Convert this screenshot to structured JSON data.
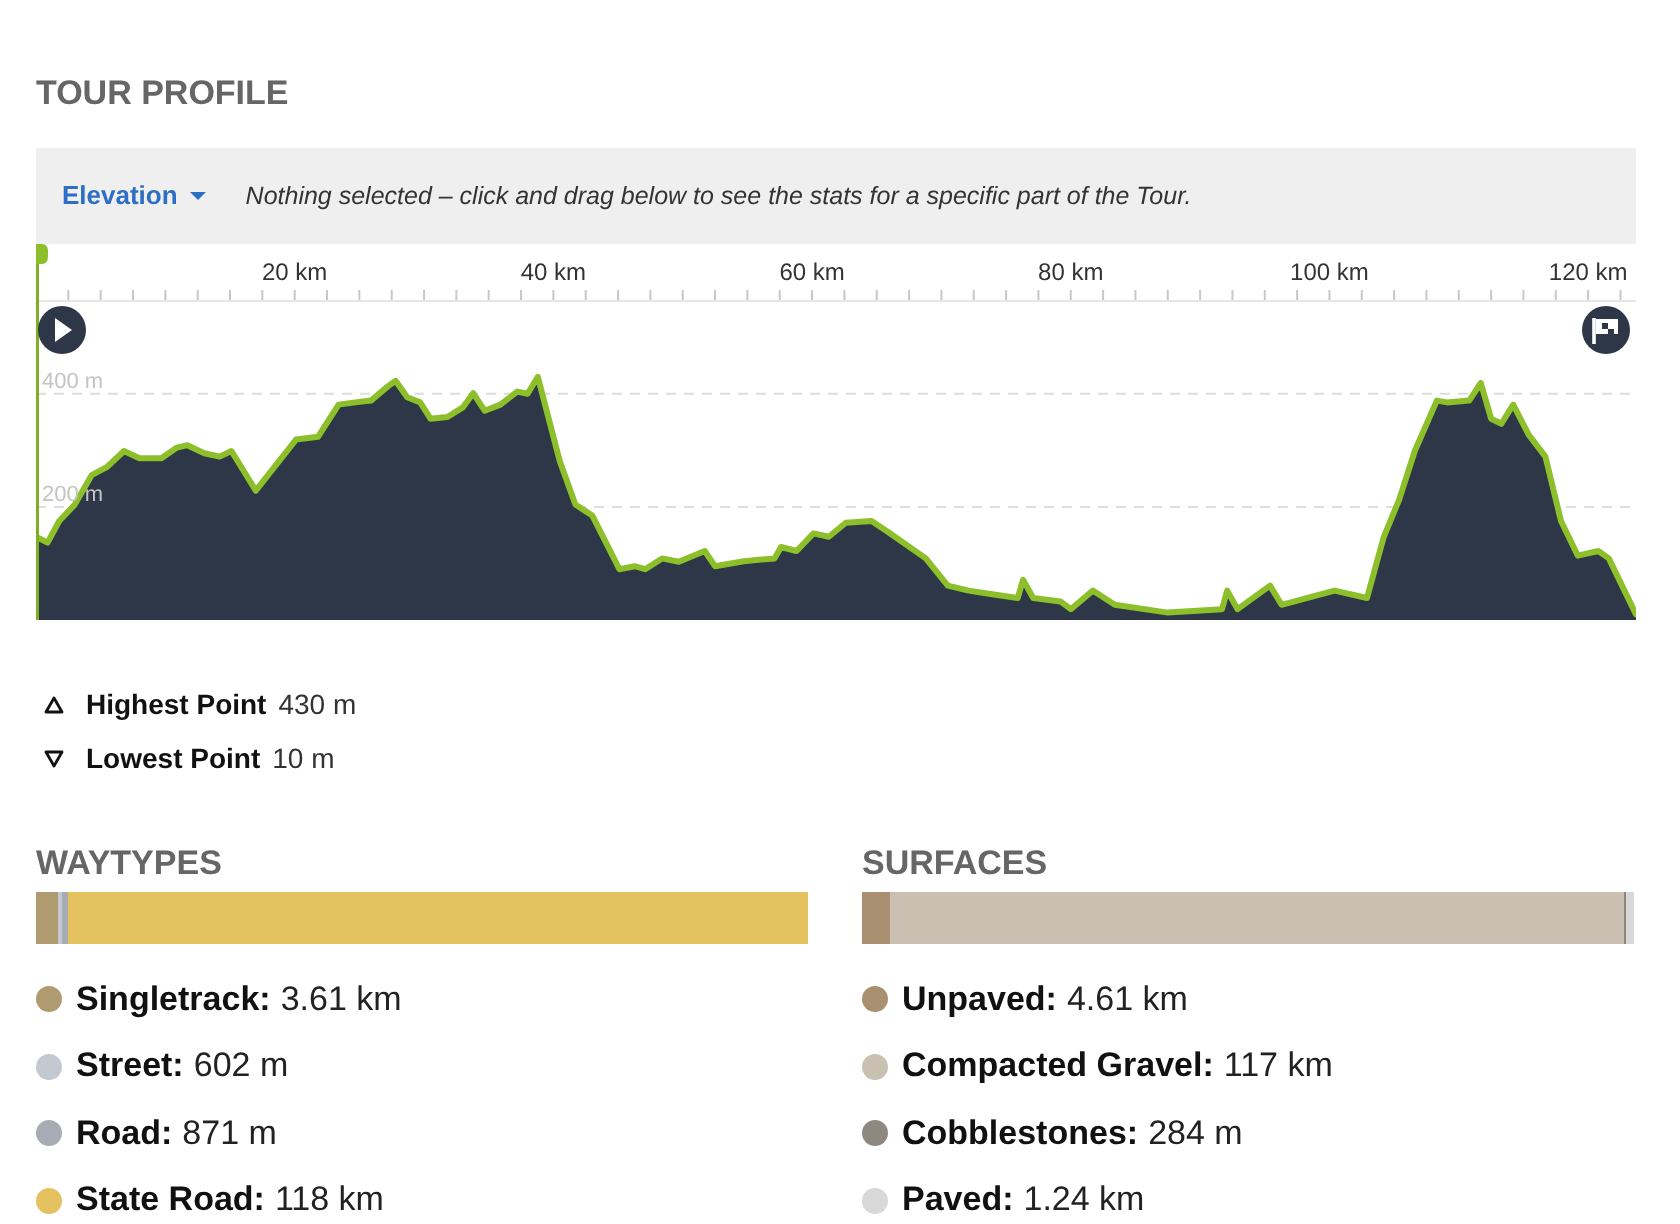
{
  "section_title": "TOUR PROFILE",
  "toolbar": {
    "dropdown": {
      "label": "Elevation"
    },
    "hint": "Nothing selected – click and drag below to see the stats for a specific part of the Tour."
  },
  "profile": {
    "chart_data": {
      "type": "area",
      "x": [
        0,
        0.9,
        1.8,
        3.0,
        4.3,
        5.5,
        6.8,
        8.0,
        9.7,
        10.9,
        11.7,
        13.0,
        14.2,
        15.1,
        17.0,
        20.1,
        21.8,
        23.4,
        24.7,
        25.9,
        27.2,
        27.8,
        28.7,
        29.7,
        30.5,
        31.8,
        33.0,
        33.8,
        34.7,
        35.9,
        37.2,
        38.0,
        38.8,
        40.5,
        41.7,
        43.0,
        45.1,
        46.3,
        47.1,
        48.4,
        49.7,
        51.7,
        52.5,
        54.7,
        57.1,
        57.6,
        58.8,
        60.1,
        61.3,
        62.6,
        64.6,
        65.8,
        68.8,
        70.5,
        72.1,
        73.8,
        75.9,
        76.3,
        77.1,
        79.2,
        80.0,
        81.7,
        83.4,
        87.5,
        91.7,
        92.1,
        92.9,
        95.4,
        96.3,
        98.8,
        100.4,
        102.9,
        104.2,
        105.4,
        106.6,
        108.3,
        109.1,
        110.8,
        111.7,
        112.5,
        113.3,
        114.2,
        115.4,
        116.7,
        117.9,
        119.2,
        120.8,
        121.6,
        123.7
      ],
      "values": [
        147,
        137,
        175,
        204,
        256,
        271,
        299,
        286,
        286,
        305,
        309,
        295,
        289,
        299,
        229,
        319,
        324,
        381,
        385,
        388,
        413,
        423,
        394,
        385,
        356,
        359,
        376,
        401,
        370,
        381,
        404,
        400,
        430,
        281,
        204,
        185,
        90,
        95,
        90,
        109,
        103,
        122,
        95,
        104,
        109,
        129,
        122,
        153,
        147,
        172,
        175,
        157,
        109,
        61,
        52,
        46,
        39,
        71,
        39,
        33,
        19,
        52,
        27,
        13,
        19,
        52,
        19,
        61,
        27,
        42,
        52,
        39,
        147,
        213,
        299,
        388,
        385,
        388,
        419,
        356,
        347,
        381,
        328,
        289,
        175,
        114,
        122,
        109,
        10
      ],
      "xlim": [
        0,
        123.7
      ],
      "ylim": [
        0,
        665
      ],
      "xticks": [
        {
          "value": 20,
          "label": "20 km"
        },
        {
          "value": 40,
          "label": "40 km"
        },
        {
          "value": 60,
          "label": "60 km"
        },
        {
          "value": 80,
          "label": "80 km"
        },
        {
          "value": 100,
          "label": "100 km"
        },
        {
          "value": 120,
          "label": "120 km"
        }
      ],
      "yticks": [
        {
          "value": 200,
          "label": "200 m"
        },
        {
          "value": 400,
          "label": "400 m"
        }
      ]
    }
  },
  "stats": [
    {
      "kind": "highest",
      "label": "Highest Point",
      "value": "430 m"
    },
    {
      "kind": "lowest",
      "label": "Lowest Point",
      "value": "10 m"
    }
  ],
  "waytypes": {
    "title": "WAYTYPES",
    "items": [
      {
        "label": "Singletrack:",
        "value": "3.61 km",
        "color": "#b09a70",
        "level": 0.029
      },
      {
        "label": "Street:",
        "value": "602 m",
        "color": "#c3c9d0",
        "level": 0.005
      },
      {
        "label": "Road:",
        "value": "871 m",
        "color": "#a7acb4",
        "level": 0.007
      },
      {
        "label": "State Road:",
        "value": "118 km",
        "color": "#e5c260",
        "level": 0.959
      }
    ]
  },
  "surfaces": {
    "title": "SURFACES",
    "items": [
      {
        "label": "Unpaved:",
        "value": "4.61 km",
        "color": "#a89070",
        "level": 0.037
      },
      {
        "label": "Compacted Gravel:",
        "value": "117 km",
        "color": "#c9c0b1",
        "level": 0.951
      },
      {
        "label": "Cobblestones:",
        "value": "284 m",
        "color": "#8e887f",
        "level": 0.002
      },
      {
        "label": "Paved:",
        "value": "1.24 km",
        "color": "#d8d8d8",
        "level": 0.01
      }
    ]
  }
}
